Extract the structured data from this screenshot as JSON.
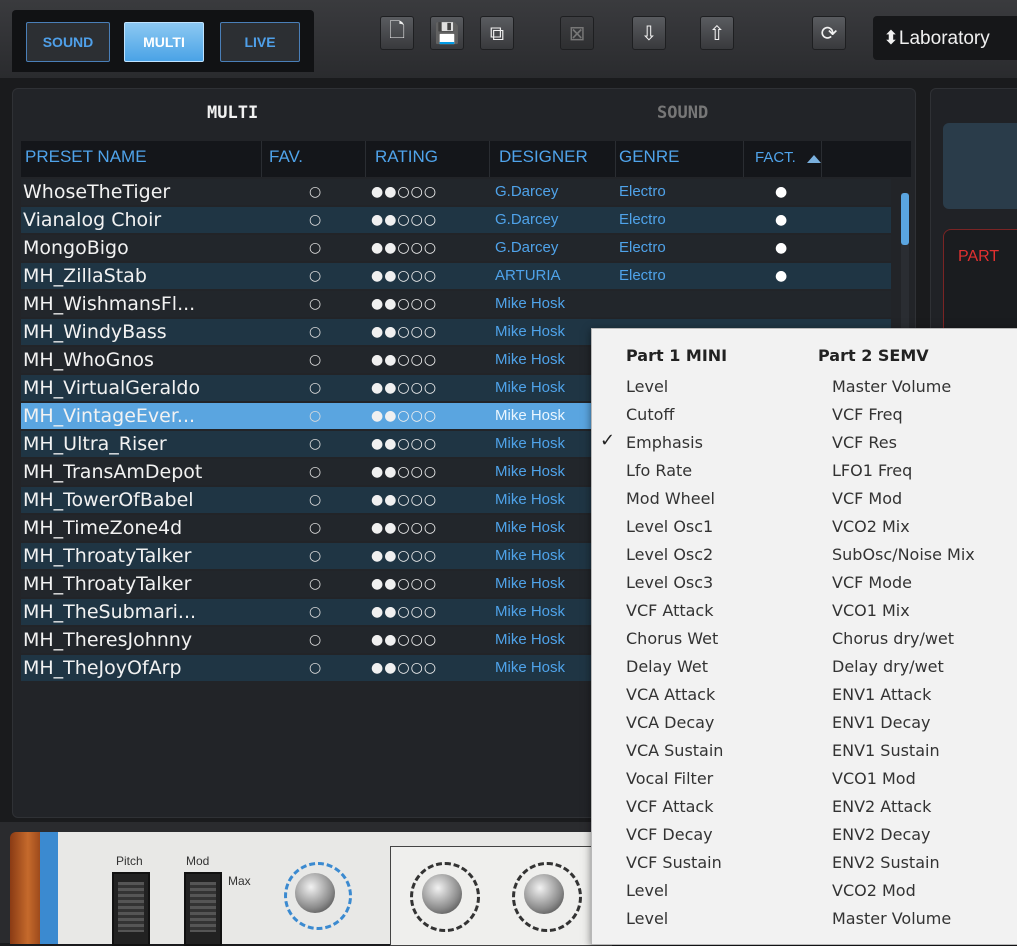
{
  "modes": [
    {
      "label": "SOUND",
      "active": false
    },
    {
      "label": "MULTI",
      "active": true
    },
    {
      "label": "LIVE",
      "active": false
    }
  ],
  "toolbar": {
    "icons": [
      "new-preset-icon",
      "save-icon",
      "save-as-icon",
      "delete-icon",
      "import-icon",
      "export-icon",
      "sync-icon"
    ],
    "new_glyph": "🗋",
    "save_glyph": "💾",
    "saveas_glyph": "⧉",
    "delete_glyph": "⊠",
    "import_glyph": "⇩",
    "export_glyph": "⇧",
    "sync_glyph": "⟳",
    "preset_label": "⬍Laboratory"
  },
  "browser": {
    "tabs": {
      "multi": "MULTI",
      "sound": "SOUND"
    },
    "columns": {
      "name": "PRESET NAME",
      "fav": "FAV.",
      "rating": "RATING",
      "designer": "DESIGNER",
      "genre": "GENRE",
      "fact": "FACT."
    },
    "rows": [
      {
        "name": "WhoseTheTiger",
        "fav": "○",
        "rating": "●●○○○",
        "designer": "G.Darcey",
        "genre": "Electro",
        "fact": "●"
      },
      {
        "name": "Vianalog Choir",
        "fav": "○",
        "rating": "●●○○○",
        "designer": "G.Darcey",
        "genre": "Electro",
        "fact": "●"
      },
      {
        "name": "MongoBigo",
        "fav": "○",
        "rating": "●●○○○",
        "designer": "G.Darcey",
        "genre": "Electro",
        "fact": "●"
      },
      {
        "name": "MH_ZillaStab",
        "fav": "○",
        "rating": "●●○○○",
        "designer": "ARTURIA",
        "genre": "Electro",
        "fact": "●"
      },
      {
        "name": "MH_WishmansFl...",
        "fav": "○",
        "rating": "●●○○○",
        "designer": "Mike Hosk",
        "genre": "",
        "fact": ""
      },
      {
        "name": "MH_WindyBass",
        "fav": "○",
        "rating": "●●○○○",
        "designer": "Mike Hosk",
        "genre": "",
        "fact": ""
      },
      {
        "name": "MH_WhoGnos",
        "fav": "○",
        "rating": "●●○○○",
        "designer": "Mike Hosk",
        "genre": "",
        "fact": ""
      },
      {
        "name": "MH_VirtualGeraldo",
        "fav": "○",
        "rating": "●●○○○",
        "designer": "Mike Hosk",
        "genre": "",
        "fact": ""
      },
      {
        "name": "MH_VintageEver...",
        "fav": "○",
        "rating": "●●○○○",
        "designer": "Mike Hosk",
        "genre": "",
        "fact": ""
      },
      {
        "name": "MH_Ultra_Riser",
        "fav": "○",
        "rating": "●●○○○",
        "designer": "Mike Hosk",
        "genre": "",
        "fact": ""
      },
      {
        "name": "MH_TransAmDepot",
        "fav": "○",
        "rating": "●●○○○",
        "designer": "Mike Hosk",
        "genre": "",
        "fact": ""
      },
      {
        "name": "MH_TowerOfBabel",
        "fav": "○",
        "rating": "●●○○○",
        "designer": "Mike Hosk",
        "genre": "",
        "fact": ""
      },
      {
        "name": "MH_TimeZone4d",
        "fav": "○",
        "rating": "●●○○○",
        "designer": "Mike Hosk",
        "genre": "",
        "fact": ""
      },
      {
        "name": "MH_ThroatyTalker",
        "fav": "○",
        "rating": "●●○○○",
        "designer": "Mike Hosk",
        "genre": "",
        "fact": ""
      },
      {
        "name": "MH_ThroatyTalker",
        "fav": "○",
        "rating": "●●○○○",
        "designer": "Mike Hosk",
        "genre": "",
        "fact": ""
      },
      {
        "name": "MH_TheSubmari...",
        "fav": "○",
        "rating": "●●○○○",
        "designer": "Mike Hosk",
        "genre": "",
        "fact": ""
      },
      {
        "name": "MH_TheresJohnny",
        "fav": "○",
        "rating": "●●○○○",
        "designer": "Mike Hosk",
        "genre": "",
        "fact": ""
      },
      {
        "name": "MH_TheJoyOfArp",
        "fav": "○",
        "rating": "●●○○○",
        "designer": "Mike Hosk",
        "genre": "",
        "fact": ""
      }
    ],
    "selected_index": 8
  },
  "right_panel": {
    "part_label": "PART"
  },
  "keyboard": {
    "pitch_label": "Pitch",
    "mod_label": "Mod",
    "max_label": "Max"
  },
  "menu": {
    "col1_header": "Part 1 MINI",
    "col2_header": "Part 2 SEMV",
    "col1": [
      "Level",
      "Cutoff",
      "Emphasis",
      "Lfo Rate",
      "Mod Wheel",
      "Level Osc1",
      "Level Osc2",
      "Level Osc3",
      "VCF Attack",
      "Chorus Wet",
      "Delay Wet",
      "VCA Attack",
      "VCA Decay",
      "VCA Sustain",
      "Vocal Filter",
      "VCF Attack",
      "VCF Decay",
      "VCF Sustain",
      "Level",
      "Level"
    ],
    "col2": [
      "Master Volume",
      "VCF Freq",
      "VCF Res",
      "LFO1 Freq",
      "VCF Mod",
      "VCO2 Mix",
      "SubOsc/Noise Mix",
      "VCF Mode",
      "VCO1 Mix",
      "Chorus dry/wet",
      "Delay dry/wet",
      "ENV1 Attack",
      "ENV1 Decay",
      "ENV1 Sustain",
      "VCO1 Mod",
      "ENV2 Attack",
      "ENV2 Decay",
      "ENV2 Sustain",
      "VCO2 Mod",
      "Master Volume"
    ],
    "checked_col": 1,
    "checked_index": 2,
    "check_glyph": "✓"
  },
  "colors": {
    "accent": "#4fa3ea",
    "selected_row": "#5aa5e0",
    "row_alt": "#1f3544"
  }
}
